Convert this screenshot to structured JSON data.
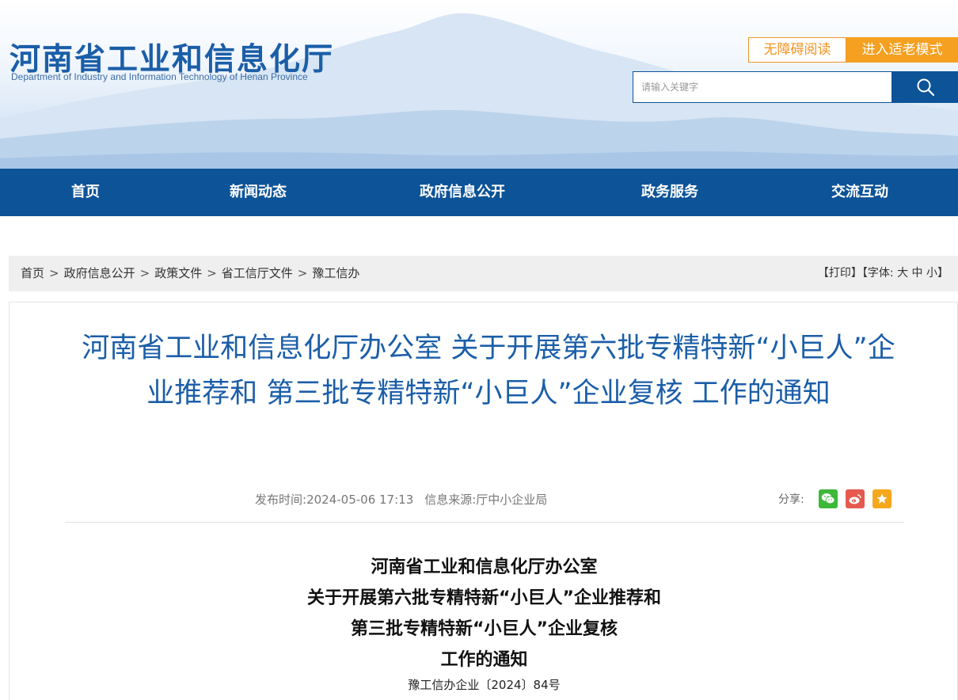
{
  "header": {
    "site_name_cn": "河南省工业和信息化厅",
    "site_name_en": "Department of Industry and Information Technology of Henan Province",
    "accessibility_label": "无障碍阅读",
    "elder_mode_label": "进入适老模式",
    "search_placeholder": "请输入关键字",
    "search_icon": "search-icon"
  },
  "nav": {
    "items": [
      {
        "label": "首页"
      },
      {
        "label": "新闻动态"
      },
      {
        "label": "政府信息公开"
      },
      {
        "label": "政务服务"
      },
      {
        "label": "交流互动"
      }
    ]
  },
  "breadcrumb": {
    "items": [
      {
        "label": "首页"
      },
      {
        "label": "政府信息公开"
      },
      {
        "label": "政策文件"
      },
      {
        "label": "省工信厅文件"
      },
      {
        "label": "豫工信办"
      }
    ],
    "separator": ">",
    "print_label": "【打印】",
    "font_label": "【字体:",
    "font_large": "大",
    "font_medium": "中",
    "font_small": "小",
    "font_close": "】"
  },
  "article": {
    "title": "河南省工业和信息化厅办公室 关于开展第六批专精特新“小巨人”企业推荐和 第三批专精特新“小巨人”企业复核 工作的通知",
    "publish_label": "发布时间:",
    "publish_time": "2024-05-06 17:13",
    "source_label": "信息来源:",
    "source": "厅中小企业局",
    "share_label": "分享:",
    "share_icons": [
      "wechat-icon",
      "weibo-icon",
      "favorite-icon"
    ],
    "share_colors": {
      "wechat": "#3db83a",
      "weibo": "#e6594e",
      "favorite": "#f5a81c"
    },
    "doc_title_lines": [
      "河南省工业和信息化厅办公室",
      "关于开展第六批专精特新“小巨人”企业推荐和",
      "第三批专精特新“小巨人”企业复核",
      "工作的通知"
    ],
    "doc_number": "豫工信办企业〔2024〕84号"
  },
  "colors": {
    "brand_blue": "#0d5397",
    "title_blue": "#1b5ea8",
    "accent_orange": "#f5a021"
  }
}
